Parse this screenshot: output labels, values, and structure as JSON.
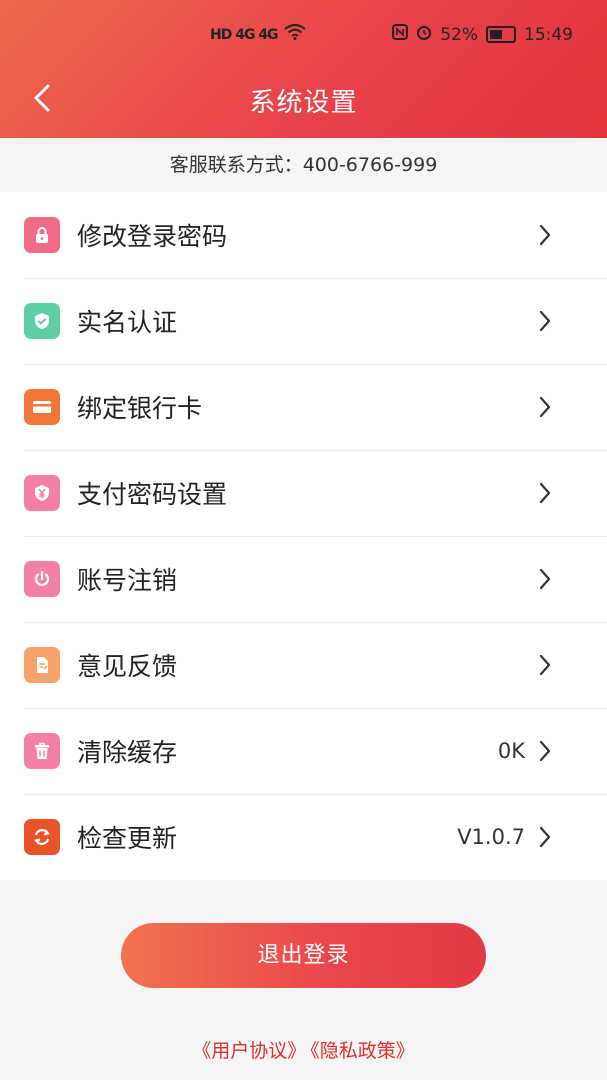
{
  "status_bar": {
    "left": "HD 4G 4G",
    "battery": "52%",
    "time": "15:49"
  },
  "nav": {
    "title": "系统设置"
  },
  "service": {
    "text": "客服联系方式：400-6766-999"
  },
  "menu": [
    {
      "label": "修改登录密码",
      "value": "",
      "icon": "lock-icon",
      "color": "#ef6b86"
    },
    {
      "label": "实名认证",
      "value": "",
      "icon": "shield-check-icon",
      "color": "#5fd0a6"
    },
    {
      "label": "绑定银行卡",
      "value": "",
      "icon": "credit-card-icon",
      "color": "#f0763a"
    },
    {
      "label": "支付密码设置",
      "value": "",
      "icon": "yen-shield-icon",
      "color": "#f47fa8"
    },
    {
      "label": "账号注销",
      "value": "",
      "icon": "power-icon",
      "color": "#f47fa8"
    },
    {
      "label": "意见反馈",
      "value": "",
      "icon": "feedback-doc-icon",
      "color": "#f7a26a"
    },
    {
      "label": "清除缓存",
      "value": "0K",
      "icon": "trash-icon",
      "color": "#f47fa8"
    },
    {
      "label": "检查更新",
      "value": "V1.0.7",
      "icon": "refresh-icon",
      "color": "#e8532a"
    }
  ],
  "logout": {
    "label": "退出登录"
  },
  "links": {
    "user_agreement": "《用户协议》",
    "privacy_policy": "《隐私政策》"
  }
}
